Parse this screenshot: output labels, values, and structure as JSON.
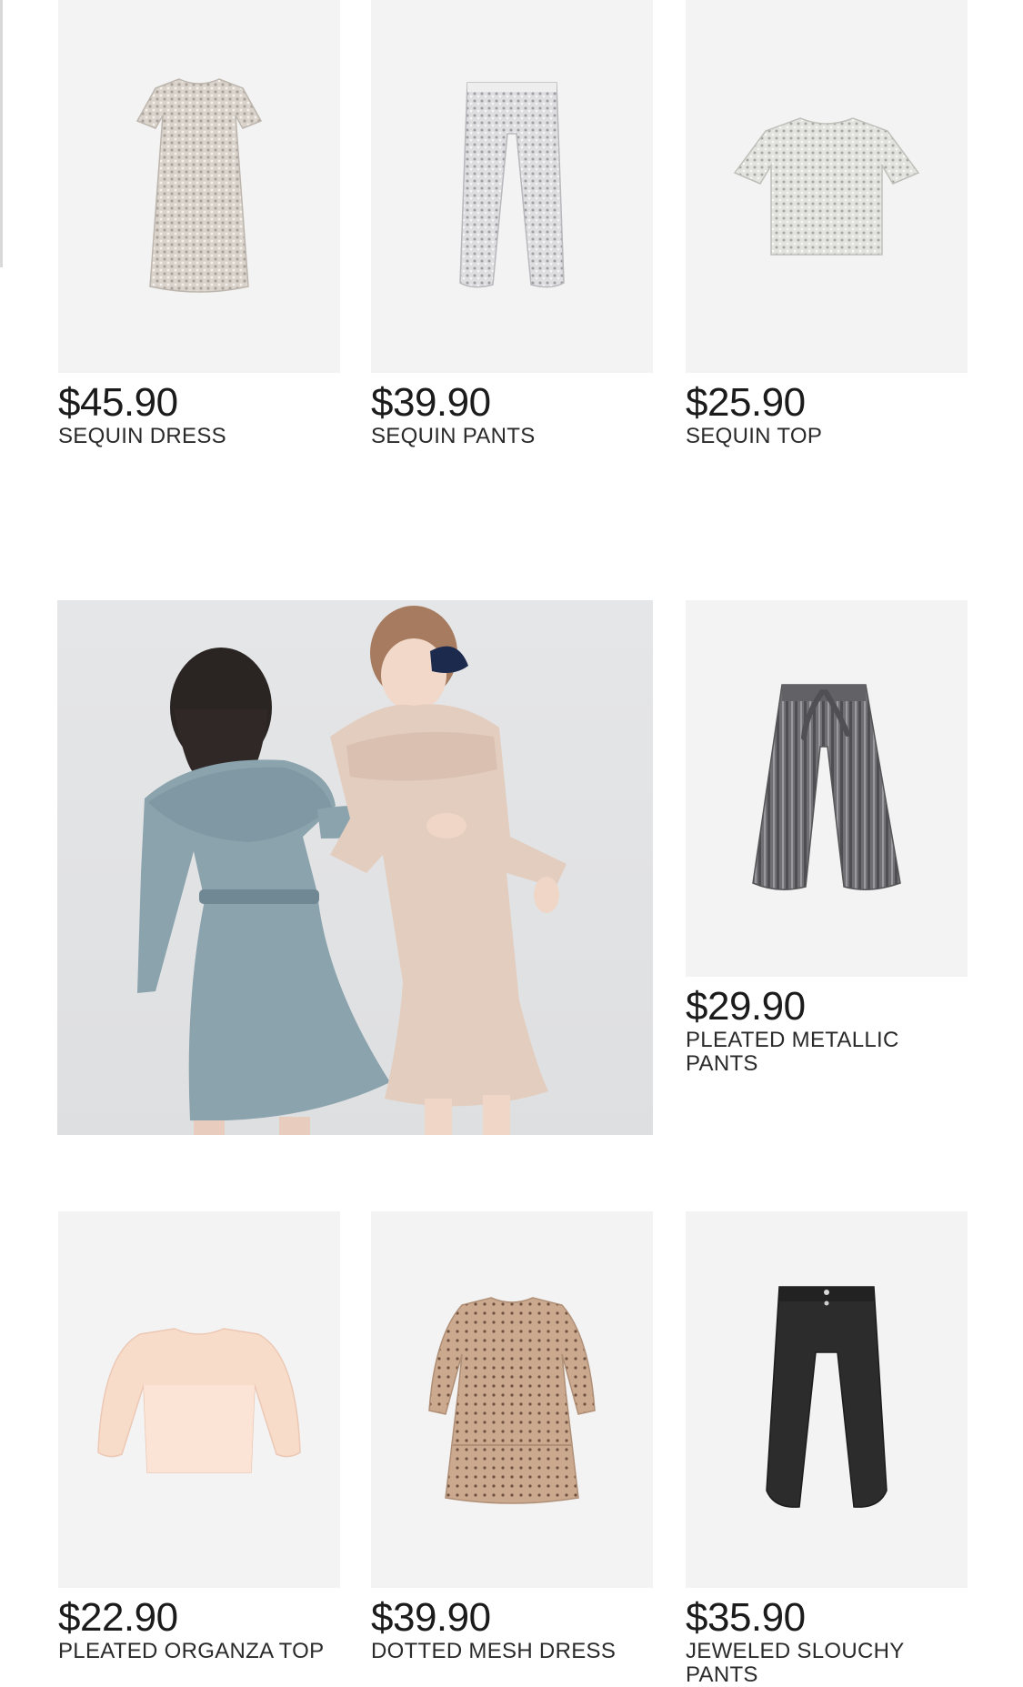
{
  "products": [
    {
      "price": "$45.90",
      "name": "SEQUIN DRESS",
      "icon": "sequin-dress-icon",
      "color": "#d8d2cb"
    },
    {
      "price": "$39.90",
      "name": "SEQUIN PANTS",
      "icon": "sequin-pants-icon",
      "color": "#d6d6d8"
    },
    {
      "price": "$25.90",
      "name": "SEQUIN TOP",
      "icon": "sequin-top-icon",
      "color": "#dcdcd8"
    },
    {
      "price": "$29.90",
      "name": "PLEATED METALLIC PANTS",
      "icon": "pleated-pants-icon",
      "color": "#6e6e70"
    },
    {
      "price": "$22.90",
      "name": "PLEATED ORGANZA TOP",
      "icon": "organza-top-icon",
      "color": "#f6d9c8"
    },
    {
      "price": "$39.90",
      "name": "DOTTED MESH DRESS",
      "icon": "dotted-dress-icon",
      "color": "#c9a990"
    },
    {
      "price": "$35.90",
      "name": "JEWELED SLOUCHY PANTS",
      "icon": "slouchy-pants-icon",
      "color": "#2b2b2b"
    }
  ],
  "campaign": {
    "icon": "campaign-photo-icon",
    "colors": {
      "background": "#e2e3e5",
      "blue_dress": "#8aa3ad",
      "pink_dress": "#e3cdbf"
    }
  }
}
